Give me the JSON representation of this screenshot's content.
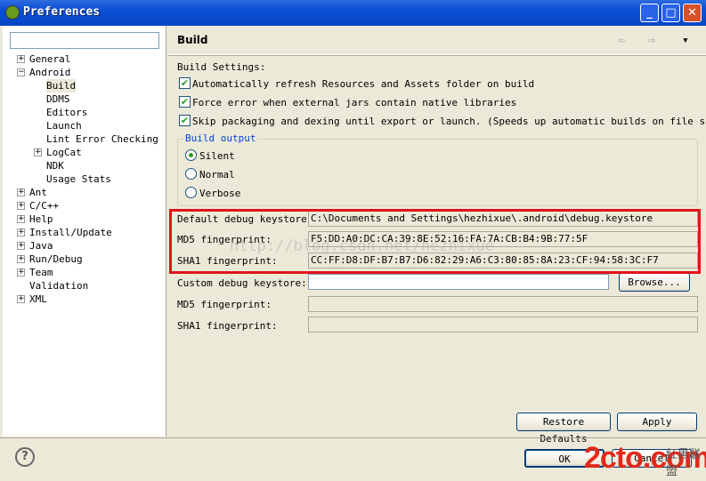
{
  "window": {
    "title": "Preferences",
    "minimize_label": "_",
    "maximize_label": "□",
    "close_label": "✕"
  },
  "sidebar": {
    "filter_placeholder": "",
    "items": [
      {
        "label": "General",
        "expander": "+"
      },
      {
        "label": "Android",
        "expander": "−"
      },
      {
        "label": "Build",
        "selected": true
      },
      {
        "label": "DDMS"
      },
      {
        "label": "Editors"
      },
      {
        "label": "Launch"
      },
      {
        "label": "Lint Error Checking"
      },
      {
        "label": "LogCat",
        "expander": "+"
      },
      {
        "label": "NDK"
      },
      {
        "label": "Usage Stats"
      },
      {
        "label": "Ant",
        "expander": "+"
      },
      {
        "label": "C/C++",
        "expander": "+"
      },
      {
        "label": "Help",
        "expander": "+"
      },
      {
        "label": "Install/Update",
        "expander": "+"
      },
      {
        "label": "Java",
        "expander": "+"
      },
      {
        "label": "Run/Debug",
        "expander": "+"
      },
      {
        "label": "Team",
        "expander": "+"
      },
      {
        "label": "Validation"
      },
      {
        "label": "XML",
        "expander": "+"
      }
    ]
  },
  "page": {
    "title": "Build",
    "back_icon": "⇦",
    "forward_icon": "⇨",
    "menu_icon": "▾",
    "settings_label": "Build Settings:",
    "checkboxes": [
      {
        "label": "Automatically refresh Resources and Assets folder on build",
        "checked": true
      },
      {
        "label": "Force error when external jars contain native libraries",
        "checked": true
      },
      {
        "label": "Skip packaging and dexing until export or launch. (Speeds up automatic builds on file save)",
        "checked": true
      }
    ],
    "output_group": {
      "title": "Build output",
      "options": [
        {
          "label": "Silent",
          "selected": true
        },
        {
          "label": "Normal",
          "selected": false
        },
        {
          "label": "Verbose",
          "selected": false
        }
      ]
    },
    "default_keystore_label": "Default debug keystore:",
    "default_keystore_value": "C:\\Documents and Settings\\hezhixue\\.android\\debug.keystore",
    "md5_label": "MD5 fingerprint:",
    "md5_value": "F5:DD:A0:DC:CA:39:8E:52:16:FA:7A:CB:B4:9B:77:5F",
    "sha1_label": "SHA1 fingerprint:",
    "sha1_value": "CC:FF:D8:DF:B7:B7:D6:82:29:A6:C3:80:85:8A:23:CF:94:58:3C:F7",
    "custom_keystore_label": "Custom debug keystore:",
    "custom_keystore_value": "",
    "browse_label": "Browse...",
    "custom_md5_label": "MD5 fingerprint:",
    "custom_md5_value": "",
    "custom_sha1_label": "SHA1 fingerprint:",
    "custom_sha1_value": "",
    "restore_label": "Restore Defaults",
    "apply_label": "Apply",
    "highlight_color": "#e0141a"
  },
  "footer": {
    "help_icon": "?",
    "ok_label": "OK",
    "cancel_label": "Cancel"
  },
  "watermarks": {
    "blog": "http://blog.csdn.net/hezhixue",
    "site": "2cto.com",
    "site_cn": "红黑联盟"
  }
}
